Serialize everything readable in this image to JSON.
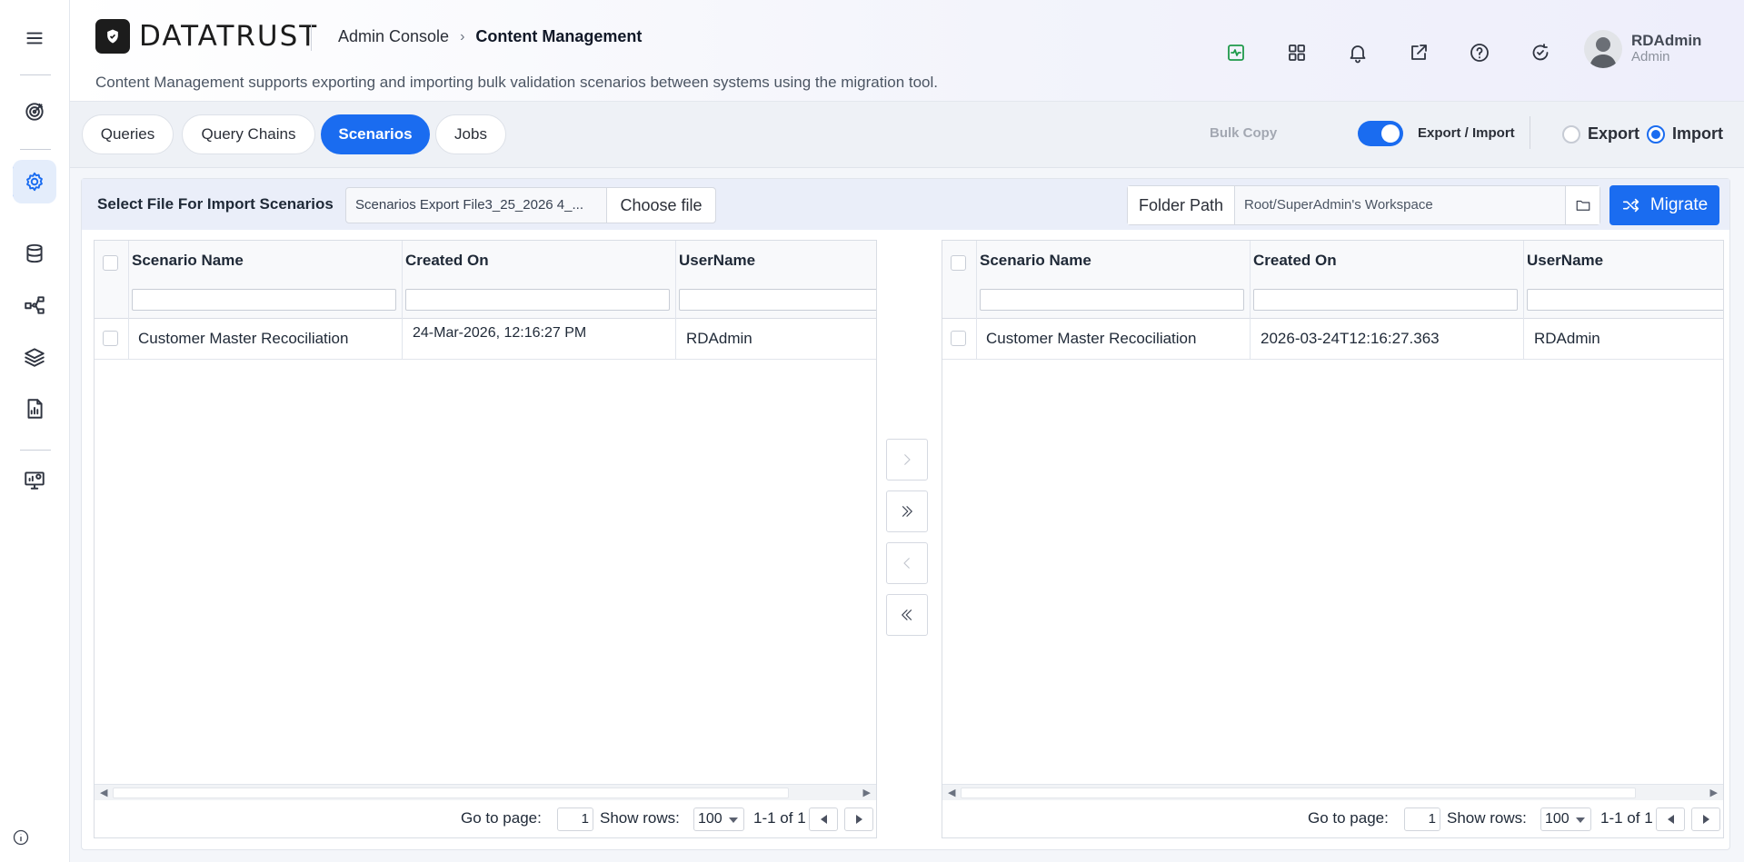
{
  "brand": {
    "name": "DATATRUST"
  },
  "breadcrumb": {
    "root": "Admin Console",
    "current": "Content Management"
  },
  "subtitle": "Content Management supports exporting and importing bulk validation scenarios between systems using the migration tool.",
  "user": {
    "name": "RDAdmin",
    "role": "Admin"
  },
  "tabs": [
    {
      "label": "Queries",
      "active": false
    },
    {
      "label": "Query Chains",
      "active": false
    },
    {
      "label": "Scenarios",
      "active": true
    },
    {
      "label": "Jobs",
      "active": false
    }
  ],
  "mode": {
    "bulk_copy_label": "Bulk Copy",
    "export_import_label": "Export / Import",
    "toggle_on": true,
    "export_label": "Export",
    "import_label": "Import",
    "selected": "Import"
  },
  "toolbar": {
    "select_label": "Select File For Import Scenarios",
    "file_name": "Scenarios Export File3_25_2026 4_...",
    "choose_file_label": "Choose file",
    "folder_path_label": "Folder Path",
    "folder_path_value": "Root/SuperAdmin's Workspace",
    "migrate_label": "Migrate"
  },
  "left_grid": {
    "columns": [
      "Scenario Name",
      "Created On",
      "UserName"
    ],
    "rows": [
      {
        "name": "Customer Master Recociliation",
        "created": "24-Mar-2026, 12:16:27 PM",
        "user": "RDAdmin"
      }
    ],
    "pager": {
      "goto_label": "Go to page:",
      "page": "1",
      "rows_label": "Show rows:",
      "rows_value": "100",
      "range": "1-1 of 1"
    }
  },
  "right_grid": {
    "columns": [
      "Scenario Name",
      "Created On",
      "UserName"
    ],
    "rows": [
      {
        "name": "Customer Master Recociliation",
        "created": "2026-03-24T12:16:27.363",
        "user": "RDAdmin"
      }
    ],
    "pager": {
      "goto_label": "Go to page:",
      "page": "1",
      "rows_label": "Show rows:",
      "rows_value": "100",
      "range": "1-1 of 1"
    }
  },
  "colors": {
    "accent": "#1a6cf0",
    "header_bg": "#f3f4fb"
  },
  "icons": {
    "rail": [
      "menu-icon",
      "target-icon",
      "settings-icon",
      "database-icon",
      "hierarchy-icon",
      "layers-icon",
      "report-icon",
      "monitor-settings-icon",
      "info-icon"
    ],
    "header": [
      "activity-icon",
      "apps-grid-icon",
      "bell-icon",
      "external-link-icon",
      "help-icon",
      "refresh-check-icon"
    ]
  }
}
